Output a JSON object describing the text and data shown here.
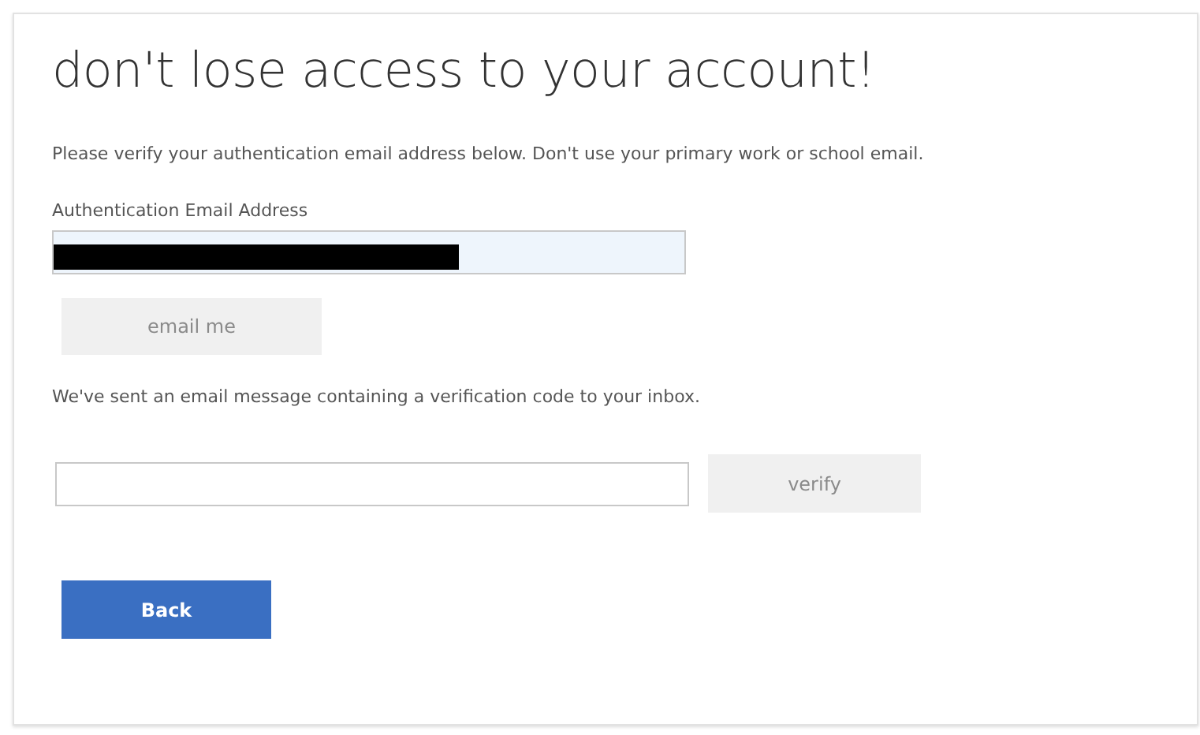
{
  "heading": "don't lose access to your account!",
  "instruction": "Please verify your authentication email address below. Don't use your primary work or school email.",
  "email_field": {
    "label": "Authentication Email Address",
    "redacted": true
  },
  "email_button": {
    "label": "email me",
    "disabled": true
  },
  "message": "We've sent an email message containing a verification code to your inbox.",
  "code_field": {
    "redacted": false
  },
  "verify_button": {
    "label": "verify",
    "disabled": true
  },
  "back_button": {
    "label": "Back",
    "disabled": false
  }
}
